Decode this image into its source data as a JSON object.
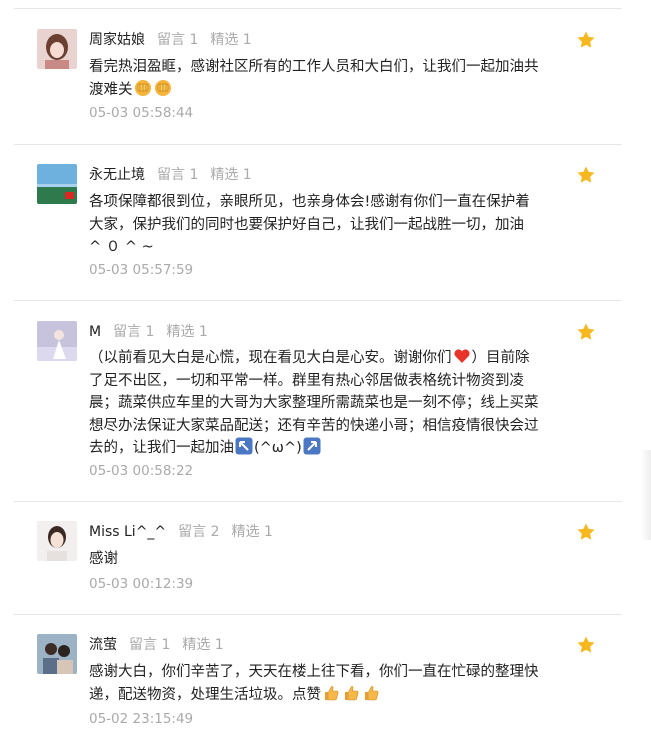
{
  "colors": {
    "star": "#f5b81e",
    "muted": "#aaaaaa",
    "divider": "#e6e6e6"
  },
  "comments": [
    {
      "nickname": "周家姑娘",
      "messages": "留言 1",
      "featured": "精选 1",
      "content": "看完热泪盈眶，感谢社区所有的工作人员和大白们，让我们一起加油共渡难关",
      "emojis": [
        "fist",
        "fist"
      ],
      "time": "05-03 05:58:44",
      "starred": true
    },
    {
      "nickname": "永无止境",
      "messages": "留言 1",
      "featured": "精选 1",
      "content": "各项保障都很到位，亲眼所见，也亲身体会!感谢有你们一直在保护着大家，保护我们的同时也要保护好自己，让我们一起战胜一切，加油 ^ ０ ^ ~",
      "time": "05-03 05:57:59",
      "starred": true
    },
    {
      "nickname": "M",
      "messages": "留言 1",
      "featured": "精选 1",
      "content_part1": "（以前看见大白是心慌，现在看见大白是心安。谢谢你们",
      "content_part2": "）目前除了足不出区，一切和平常一样。群里有热心邻居做表格统计物资到凌晨；蔬菜供应车里的大哥为大家整理所需蔬菜也是一刻不停；线上买菜想尽办法保证大家菜品配送；还有辛苦的快递小哥；相信疫情很快会过去的，让我们一起加油",
      "content_part3": "(^ω^)",
      "time": "05-03 00:58:22",
      "starred": true
    },
    {
      "nickname": "Miss Li^_^",
      "messages": "留言 2",
      "featured": "精选 1",
      "content": "感谢",
      "time": "05-03 00:12:39",
      "starred": true
    },
    {
      "nickname": "流萤",
      "messages": "留言 1",
      "featured": "精选 1",
      "content": "感谢大白，你们辛苦了，天天在楼上往下看，你们一直在忙碌的整理快递，配送物资，处理生活垃圾。点赞",
      "time": "05-02 23:15:49",
      "starred": true
    }
  ]
}
